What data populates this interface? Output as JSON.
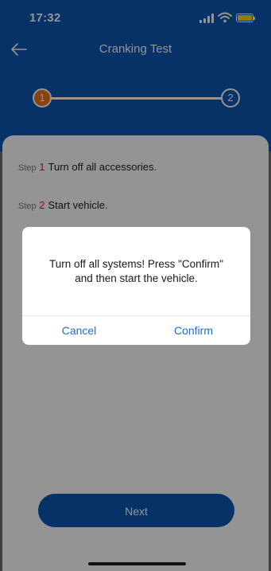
{
  "status_bar": {
    "time": "17:32",
    "icons": [
      "cellular-signal-icon",
      "wifi-icon",
      "battery-icon"
    ],
    "battery_color": "#ffd60a"
  },
  "nav": {
    "back_icon": "back-arrow-icon",
    "title": "Cranking Test"
  },
  "stepper": {
    "steps": [
      {
        "number": "1",
        "state": "active"
      },
      {
        "number": "2",
        "state": "inactive"
      }
    ],
    "active_color": "#e8761a"
  },
  "instructions": [
    {
      "prefix": "Step",
      "number": "1",
      "text": "Turn off all accessories."
    },
    {
      "prefix": "Step",
      "number": "2",
      "text": "Start vehicle."
    }
  ],
  "next_button": {
    "label": "Next"
  },
  "dialog": {
    "message_line1": "Turn off all systems! Press \"Confirm\"",
    "message_line2": "and then start the vehicle.",
    "cancel_label": "Cancel",
    "confirm_label": "Confirm"
  },
  "colors": {
    "primary": "#0d56b3",
    "link": "#1a6fd1",
    "step_number": "#e02020"
  }
}
